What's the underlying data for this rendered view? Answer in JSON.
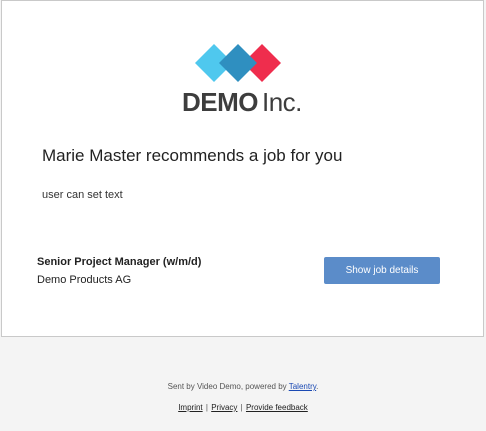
{
  "logo": {
    "text_bold": "DEMO",
    "text_light": "Inc.",
    "colors": {
      "left_diamond": "#4fc8ee",
      "middle_diamond": "#2f8fc0",
      "right_diamond": "#ef2d4d"
    }
  },
  "email": {
    "headline": "Marie Master recommends a job for you",
    "message": "user can set text"
  },
  "job": {
    "title": "Senior Project Manager (w/m/d)",
    "company": "Demo Products AG",
    "button_label": "Show job details"
  },
  "footer": {
    "sent_by_prefix": "Sent by Video Demo, powered by ",
    "brand_link": "Talentry",
    "sent_by_suffix": ".",
    "links": {
      "imprint": "Imprint",
      "privacy": "Privacy",
      "feedback": "Provide feedback"
    },
    "separator": "|"
  },
  "colors": {
    "button": "#5b8cc9",
    "card_border": "#c9c9c9",
    "background": "#f4f4f4"
  }
}
